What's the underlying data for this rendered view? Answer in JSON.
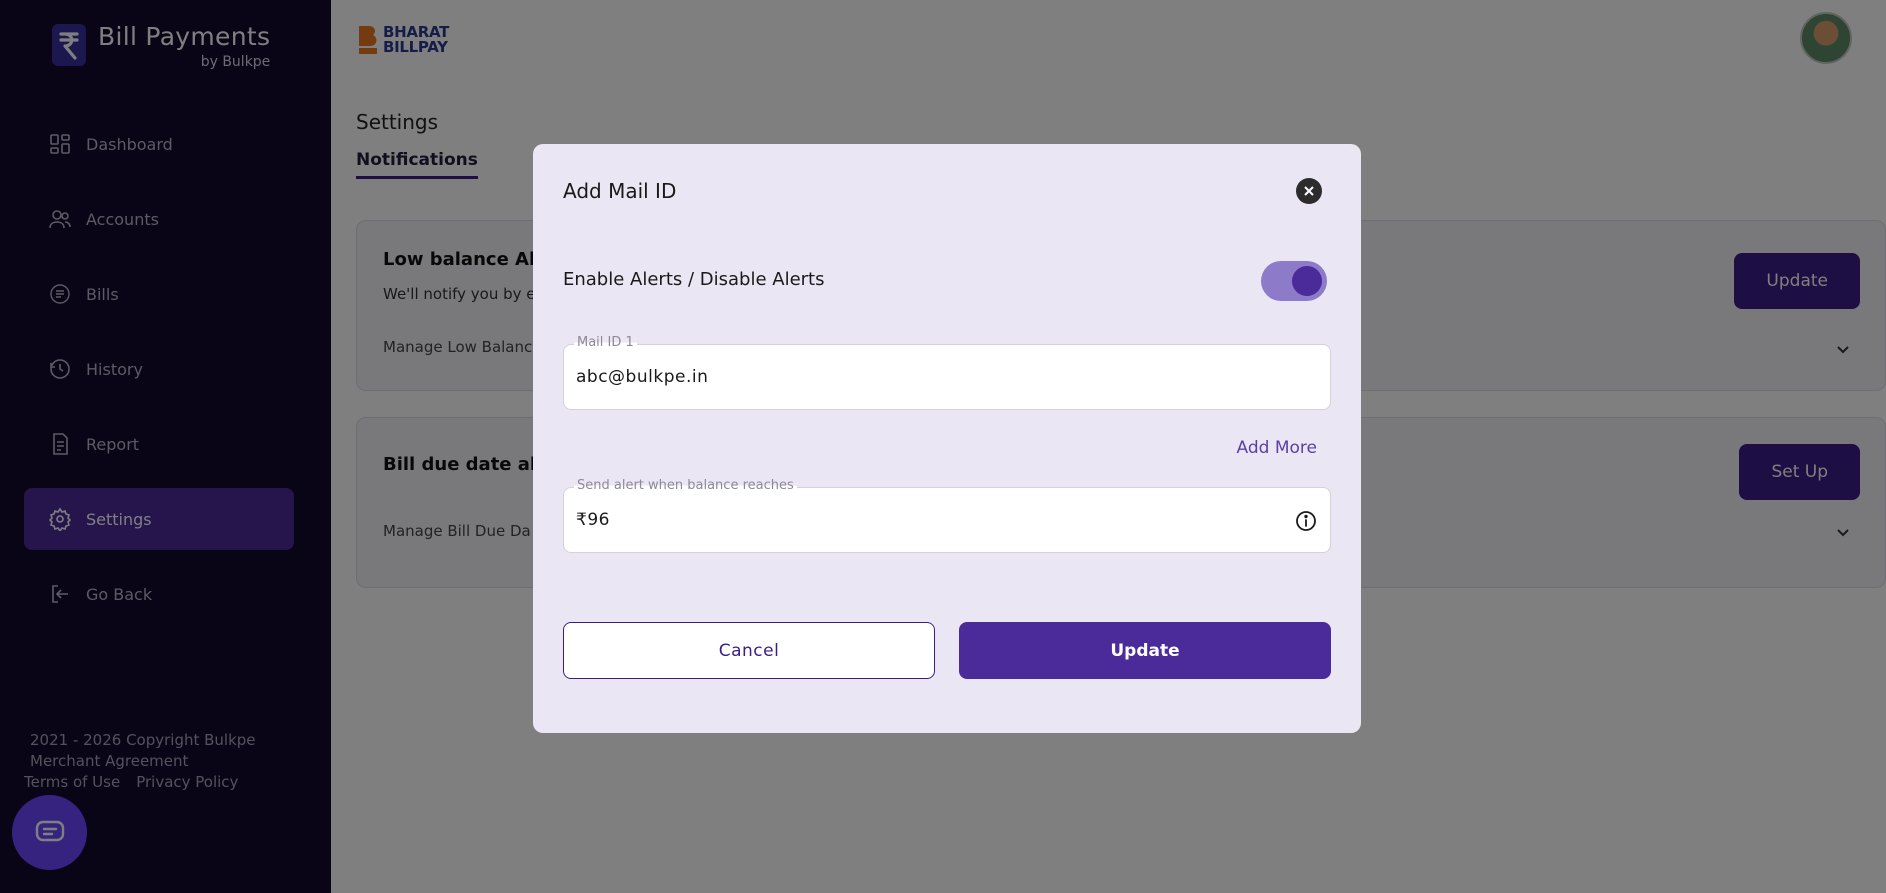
{
  "sidebar": {
    "brand_title": "Bill Payments",
    "brand_sub": "by Bulkpe",
    "items": [
      {
        "label": "Dashboard",
        "icon": "dashboard-icon"
      },
      {
        "label": "Accounts",
        "icon": "users-icon"
      },
      {
        "label": "Bills",
        "icon": "bill-icon"
      },
      {
        "label": "History",
        "icon": "history-icon"
      },
      {
        "label": "Report",
        "icon": "report-icon"
      },
      {
        "label": "Settings",
        "icon": "gear-icon",
        "active": true
      },
      {
        "label": "Go Back",
        "icon": "logout-icon"
      }
    ],
    "footer": {
      "copyright": "2021 - 2026 Copyright Bulkpe",
      "merchant": "Merchant Agreement",
      "terms": "Terms of Use",
      "privacy": "Privacy Policy"
    },
    "chat_icon": "chat-icon"
  },
  "header": {
    "logo_line1": "BHARAT",
    "logo_line2": "BILLPAY"
  },
  "main": {
    "page_title": "Settings",
    "tab": "Notifications",
    "card1": {
      "title": "Low balance Ale",
      "subtitle": "We'll notify you by e",
      "manage": "Manage Low Balanc",
      "button": "Update"
    },
    "card2": {
      "title": "Bill due date ale",
      "manage": "Manage Bill Due Da",
      "button": "Set Up"
    }
  },
  "modal": {
    "title": "Add Mail ID",
    "toggle_label": "Enable Alerts / Disable Alerts",
    "toggle_on": true,
    "mail_label": "Mail ID 1",
    "mail_value": "abc@bulkpe.in",
    "add_more": "Add More",
    "balance_label": "Send alert when balance reaches",
    "balance_value": "₹96",
    "cancel": "Cancel",
    "update": "Update"
  },
  "colors": {
    "sidebar_bg": "#120a2f",
    "accent": "#4b2a99",
    "modal_bg": "#ebe6f4"
  }
}
